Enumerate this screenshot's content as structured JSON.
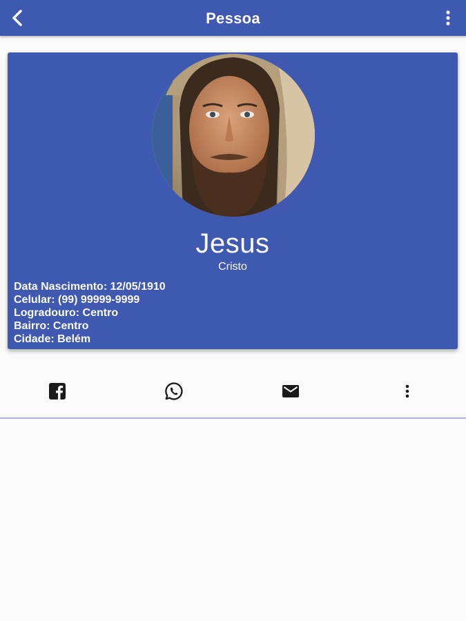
{
  "appbar": {
    "title": "Pessoa",
    "back_icon": "chevron-left-icon",
    "menu_icon": "more-vertical-icon",
    "color": "#3f59b1"
  },
  "profile": {
    "avatar": "person-photo",
    "name": "Jesus",
    "surname": "Cristo",
    "details": [
      "Data Nascimento: 12/05/1910",
      "Celular: (99) 99999-9999",
      "Logradouro: Centro",
      "Bairro: Centro",
      "Cidade: Belém"
    ]
  },
  "actions": [
    {
      "icon": "facebook-icon"
    },
    {
      "icon": "whatsapp-icon"
    },
    {
      "icon": "email-icon"
    },
    {
      "icon": "more-vertical-icon"
    }
  ],
  "colors": {
    "primary": "#3f59b1",
    "background": "#fafafa",
    "divider": "#a7b3e0"
  }
}
